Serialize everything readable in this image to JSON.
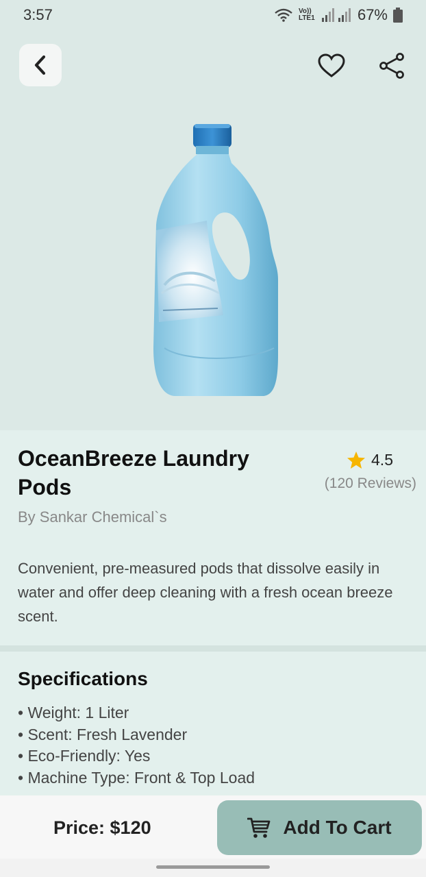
{
  "status_bar": {
    "time": "3:57",
    "network_label": "Vo)) LTE1",
    "battery": "67%",
    "icons": [
      "wifi-icon",
      "signal-icon",
      "battery-icon"
    ]
  },
  "header": {
    "back_icon": "chevron-left-icon",
    "favorite_icon": "heart-icon",
    "share_icon": "share-icon"
  },
  "product": {
    "title": "OceanBreeze Laundry Pods",
    "rating": "4.5",
    "reviews": "(120 Reviews)",
    "brand": "By Sankar Chemical`s",
    "description": "Convenient, pre-measured pods that dissolve easily in water and offer deep cleaning with a fresh ocean breeze scent.",
    "image": "laundry-bottle-image"
  },
  "specifications": {
    "title": "Specifications",
    "items": [
      "Weight: 1 Liter",
      "Scent: Fresh Lavender",
      "Eco-Friendly: Yes",
      "Machine Type: Front & Top Load"
    ]
  },
  "bottom_bar": {
    "price": "Price: $120",
    "cart_label": "Add To Cart",
    "cart_icon": "cart-icon"
  },
  "colors": {
    "background": "#e3f0ed",
    "hero_background": "#dce9e6",
    "button_accent": "#98bdb6",
    "star": "#f6b500"
  }
}
